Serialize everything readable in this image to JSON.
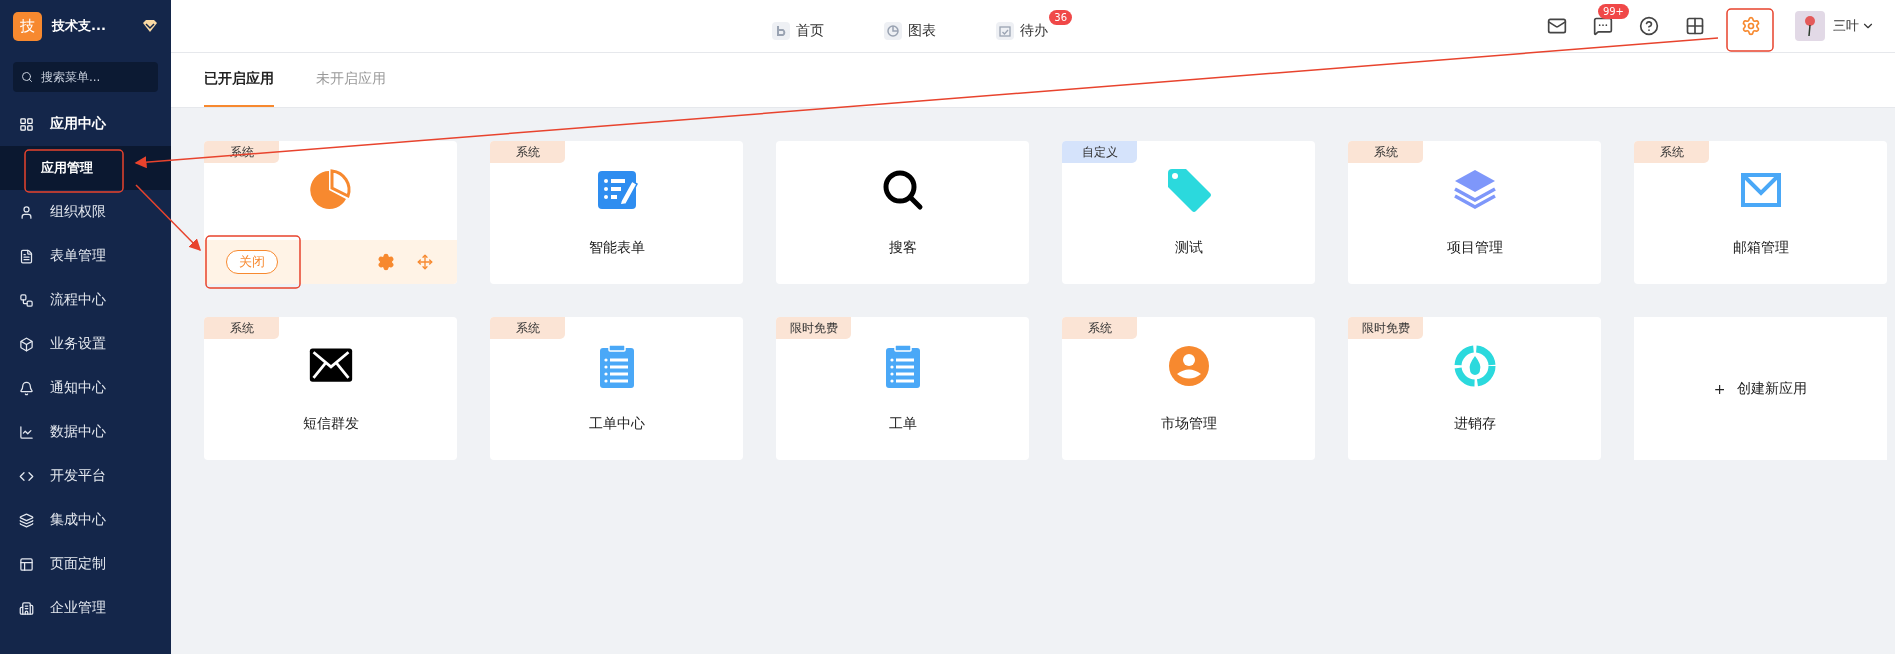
{
  "sidebar": {
    "brand": {
      "logo": "技",
      "name": "技术支..."
    },
    "search": {
      "placeholder": "搜索菜单..."
    },
    "items": [
      {
        "label": "应用中心",
        "expanded": true,
        "children": [
          {
            "label": "应用管理",
            "selected": true
          }
        ]
      },
      {
        "label": "组织权限"
      },
      {
        "label": "表单管理"
      },
      {
        "label": "流程中心"
      },
      {
        "label": "业务设置"
      },
      {
        "label": "通知中心"
      },
      {
        "label": "数据中心"
      },
      {
        "label": "开发平台"
      },
      {
        "label": "集成中心"
      },
      {
        "label": "页面定制"
      },
      {
        "label": "企业管理"
      }
    ]
  },
  "top_nav": [
    {
      "label": "首页"
    },
    {
      "label": "图表"
    },
    {
      "label": "待办",
      "badge": "36"
    }
  ],
  "top_actions": {
    "message_badge": "99+",
    "user": "三叶"
  },
  "tabs": [
    {
      "label": "已开启应用",
      "selected": true
    },
    {
      "label": "未开启应用",
      "selected": false
    }
  ],
  "apps": [
    {
      "kind": "app",
      "tag": "系统",
      "color": "#fbe4d5",
      "hovered": true,
      "close": "关闭"
    },
    {
      "kind": "app",
      "tag": "系统",
      "color": "#fbe4d5",
      "hovered": false,
      "name": "智能表单"
    },
    {
      "kind": "app",
      "hovered": false,
      "name": "搜客"
    },
    {
      "kind": "app",
      "tag": "自定义",
      "color": "#d5e3fb",
      "hovered": false,
      "name": "测试"
    },
    {
      "kind": "app",
      "tag": "系统",
      "color": "#fbe4d5",
      "hovered": false,
      "name": "项目管理"
    },
    {
      "kind": "app",
      "tag": "系统",
      "color": "#fbe4d5",
      "hovered": false,
      "name": "邮箱管理"
    },
    {
      "kind": "app",
      "tag": "系统",
      "color": "#fbe4d5",
      "hovered": false,
      "name": "短信群发"
    },
    {
      "kind": "app",
      "tag": "系统",
      "color": "#fbe4d5",
      "hovered": false,
      "name": "工单中心"
    },
    {
      "kind": "app",
      "tag": "限时免费",
      "color": "#fbe4d5",
      "hovered": false,
      "name": "工单"
    },
    {
      "kind": "app",
      "tag": "系统",
      "color": "#fbe4d5",
      "hovered": false,
      "name": "市场管理"
    },
    {
      "kind": "app",
      "tag": "限时免费",
      "color": "#fbe4d5",
      "hovered": false,
      "name": "进销存"
    },
    {
      "kind": "create",
      "sign": "+",
      "name": "创建新应用"
    }
  ]
}
